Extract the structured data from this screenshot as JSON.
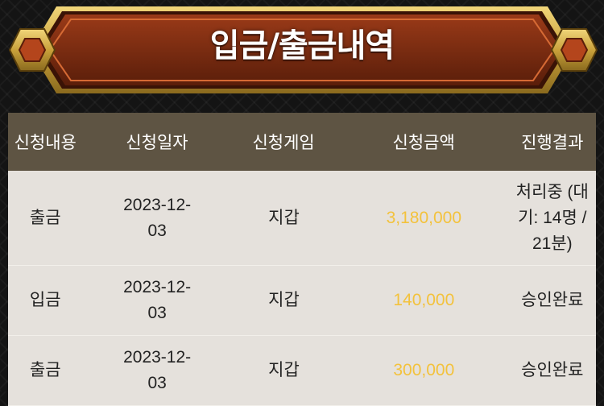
{
  "banner": {
    "title": "입금/출금내역"
  },
  "colors": {
    "accent_amount": "#f3c23c",
    "header_bg": "#5e5443",
    "banner_red": "#7e2a10",
    "gold": "#c9a13b"
  },
  "table": {
    "headers": [
      "신청내용",
      "신청일자",
      "신청게임",
      "신청금액",
      "진행결과"
    ],
    "rows": [
      {
        "type": "출금",
        "date": "2023-12-03",
        "game": "지갑",
        "amount": "3,180,000",
        "status": "처리중 (대기: 14명 / 21분)"
      },
      {
        "type": "입금",
        "date": "2023-12-03",
        "game": "지갑",
        "amount": "140,000",
        "status": "승인완료"
      },
      {
        "type": "출금",
        "date": "2023-12-03",
        "game": "지갑",
        "amount": "300,000",
        "status": "승인완료"
      }
    ]
  }
}
